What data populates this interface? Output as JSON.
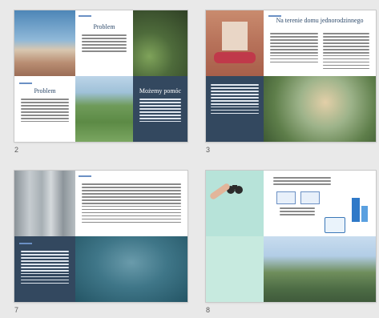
{
  "slides": [
    {
      "number": "2",
      "title_left": "Problem",
      "title_top": "Problem",
      "title_right": "Możemy pomóc"
    },
    {
      "number": "3",
      "title": "Na terenie domu jednorodzinnego"
    },
    {
      "number": "7"
    },
    {
      "number": "8"
    }
  ],
  "colors": {
    "background": "#e9e9e9",
    "navy": "#33485f",
    "title": "#2e4a6b",
    "accent": "#6b90c4"
  }
}
